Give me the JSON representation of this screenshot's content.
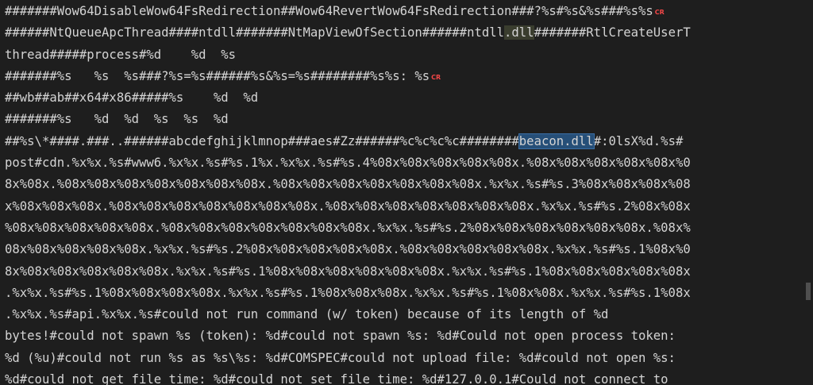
{
  "lines": [
    "#######Wow64DisableWow64FsRedirection##Wow64RevertWow64FsRedirection###?%s#%s&%s###%s%s",
    "######NtQueueApcThread####ntdll#######NtMapViewOfSection######ntdll",
    "thread#####process#%d    %d  %s",
    "#######%s   %s  %s###?%s=%s######%s&%s=%s########%s%s: %s",
    "##wb##ab##x64#x86#####%s    %d  %d",
    "#######%s   %d  %d  %s  %s  %d",
    "##%s\\*####.###..######abcdefghijklmnop###aes#Zz######%c%c%c%c########",
    "post#cdn.%x%x.%s#www6.%x%x.%s#%s.1%x.%x%x.%s#%s.4%08x%08x%08x%08x%08x.%08x%08x%08x%08x%08x%0",
    "8x%08x.%08x%08x%08x%08x%08x%08x%08x.%08x%08x%08x%08x%08x%08x%08x.%x%x.%s#%s.3%08x%08x%08x%08",
    "x%08x%08x%08x.%08x%08x%08x%08x%08x%08x%08x.%08x%08x%08x%08x%08x%08x%08x.%x%x.%s#%s.2%08x%08x",
    "%08x%08x%08x%08x%08x.%08x%08x%08x%08x%08x%08x%08x.%x%x.%s#%s.2%08x%08x%08x%08x%08x%08x.%08x%",
    "08x%08x%08x%08x%08x.%x%x.%s#%s.2%08x%08x%08x%08x%08x.%08x%08x%08x%08x%08x.%x%x.%s#%s.1%08x%0",
    "8x%08x%08x%08x%08x%08x.%x%x.%s#%s.1%08x%08x%08x%08x%08x%08x.%x%x.%s#%s.1%08x%08x%08x%08x%08x",
    ".%x%x.%s#%s.1%08x%08x%08x%08x.%x%x.%s#%s.1%08x%08x%08x.%x%x.%s#%s.1%08x%08x.%x%x.%s#%s.1%08x",
    ".%x%x.%s#api.%x%x.%s#could not run command (w/ token) because of its length of %d",
    "bytes!#could not spawn %s (token): %d#could not spawn %s: %d#Could not open process token:",
    "%d (%u)#could not run %s as %s\\%s: %d#COMSPEC#could not upload file: %d#could not open %s:",
    "%d#could not get file time: %d#could not set file time: %d#127.0.0.1#Could not connect to"
  ],
  "line2_highlight": ".dll",
  "line2_tail": "#######RtlCreateUserT",
  "line7_highlight": "beacon.dll",
  "line7_tail": "#:0lsX%d.%s#",
  "cr_marker": "CR",
  "colors": {
    "background": "#1e1e1e",
    "text": "#d4d4d4",
    "selection": "#264f78",
    "match_highlight": "#3a3d2e",
    "cr_marker": "#f44747"
  }
}
